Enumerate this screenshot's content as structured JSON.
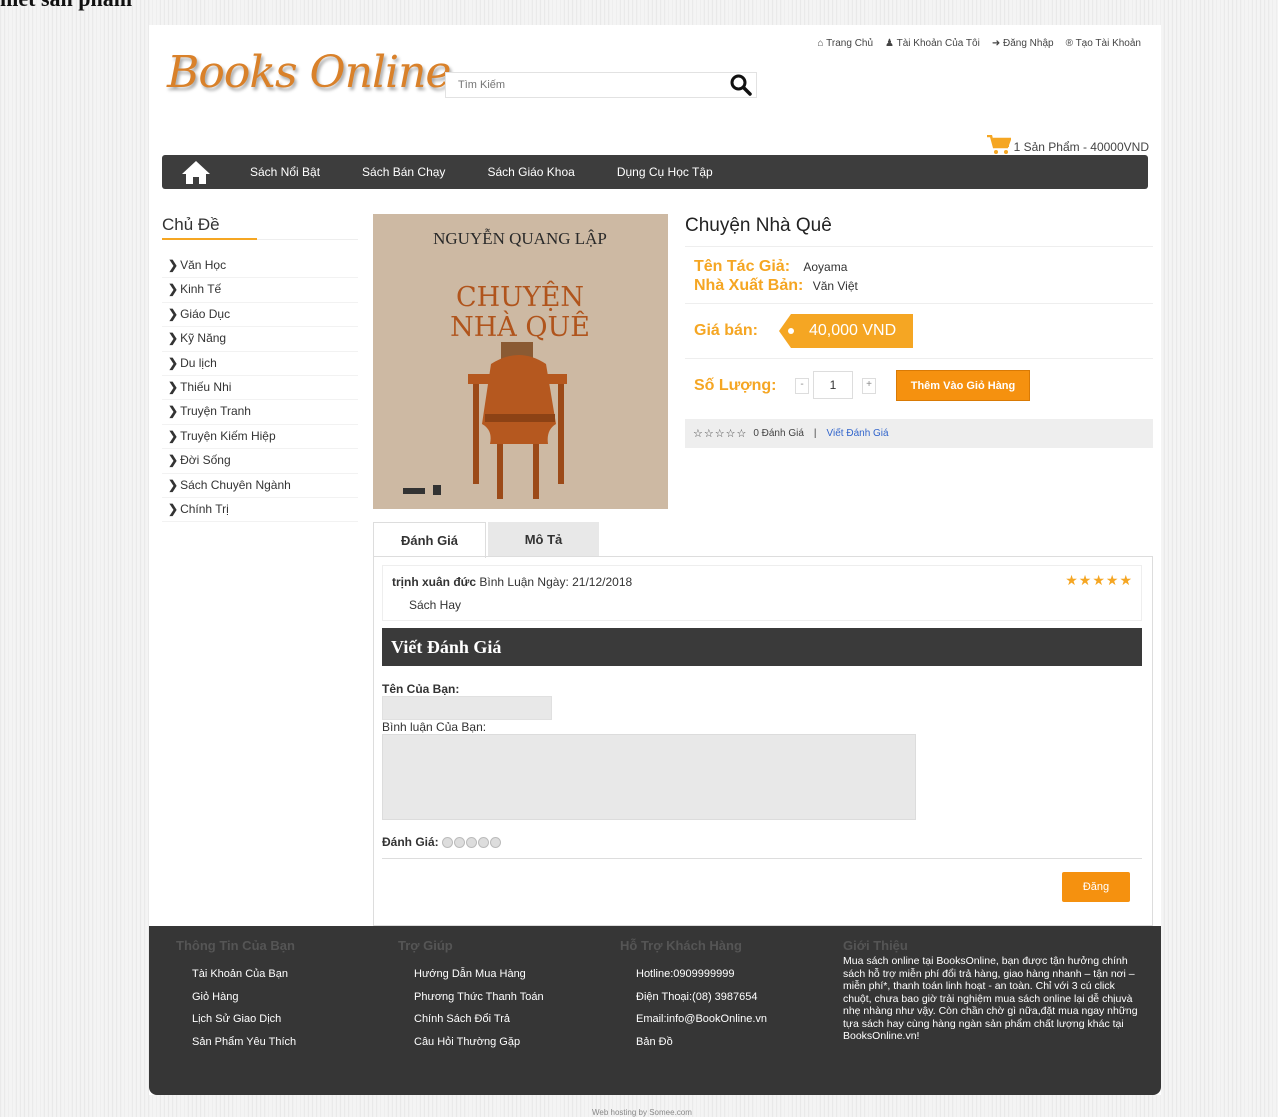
{
  "caption": "hiết sản phẩm",
  "header": {
    "logo": "Books Online",
    "search_placeholder": "Tìm Kiếm",
    "top_links": [
      "Trang Chủ",
      "Tài Khoản Của Tôi",
      "Đăng Nhập",
      "Tạo Tài Khoản"
    ],
    "cart": "1 Sản Phẩm - 40000VND"
  },
  "nav": {
    "items": [
      "Sách Nổi Bật",
      "Sách Bán Chạy",
      "Sách Giáo Khoa",
      "Dụng Cụ Học Tập"
    ]
  },
  "sidebar": {
    "title": "Chủ Đề",
    "items": [
      "Văn Học",
      "Kinh Tế",
      "Giáo Dục",
      "Kỹ Năng",
      "Du lịch",
      "Thiếu Nhi",
      "Truyện Tranh",
      "Truyện Kiếm Hiệp",
      "Đời Sống",
      "Sách Chuyên Ngành",
      "Chính Trị"
    ]
  },
  "cover": {
    "author": "NGUYỄN QUANG LẬP",
    "title_line1": "CHUYỆN",
    "title_line2": "NHÀ QUÊ"
  },
  "product": {
    "title": "Chuyện Nhà Quê",
    "author_label": "Tên Tác Giả:",
    "author": "Aoyama",
    "publisher_label": "Nhà Xuất Bản:",
    "publisher": "Văn Việt",
    "price_label": "Giá bán:",
    "price": "40,000 VND",
    "qty_label": "Số Lượng:",
    "qty": "1",
    "qty_minus": "-",
    "qty_plus": "+",
    "add_to_cart": "Thêm Vào Giỏ Hàng",
    "rating_stars": "☆☆☆☆☆",
    "rating_count": "0 Đánh Giá",
    "separator": "|",
    "write_review_link": "Viết Đánh Giá"
  },
  "tabs": [
    "Đánh Giá",
    "Mô Tả"
  ],
  "reviews": [
    {
      "name": "trịnh xuân đức",
      "meta": "Bình Luận Ngày: 21/12/2018",
      "text": "Sách Hay",
      "stars": "★★★★★"
    }
  ],
  "review_form": {
    "heading": "Viết Đánh Giá",
    "name_label": "Tên Của Bạn:",
    "comment_label": "Bình luận Của Bạn:",
    "rating_label": "Đánh Giá:",
    "submit": "Đăng"
  },
  "footer": {
    "col1": {
      "title": "Thông Tin Của Bạn",
      "links": [
        "Tài Khoản Của Bạn",
        "Giỏ Hàng",
        "Lịch Sử Giao Dịch",
        "Sản Phẩm Yêu Thích"
      ]
    },
    "col2": {
      "title": "Trợ Giúp",
      "links": [
        "Hướng Dẫn Mua Hàng",
        "Phương Thức Thanh Toán",
        "Chính Sách Đổi Trả",
        "Câu Hỏi Thường Gặp"
      ]
    },
    "col3": {
      "title": "Hỗ Trợ Khách Hàng",
      "links": [
        "Hotline:0909999999",
        "Điện Thoại:(08) 3987654",
        "Email:info@BookOnline.vn",
        "Bản Đồ"
      ]
    },
    "col4": {
      "title": "Giới Thiệu",
      "text": "Mua sách online tại BooksOnline, bạn được tận hưởng chính sách hỗ trợ miễn phí đổi trả hàng, giao hàng nhanh – tận nơi – miễn phí*, thanh toán linh hoạt - an toàn. Chỉ với 3 cú click chuột, chưa bao giờ trải nghiệm mua sách online lại dễ chịuvà nhẹ nhàng như vậy. Còn chần chờ gì nữa,đặt mua ngay những tựa sách hay cùng hàng ngàn sản phẩm chất lượng khác tại BooksOnline.vn!"
    }
  },
  "credit": "Web hosting by Somee.com",
  "colors": {
    "accent": "#f5a623",
    "button": "#f5910f",
    "dark": "#3d3d3d"
  }
}
